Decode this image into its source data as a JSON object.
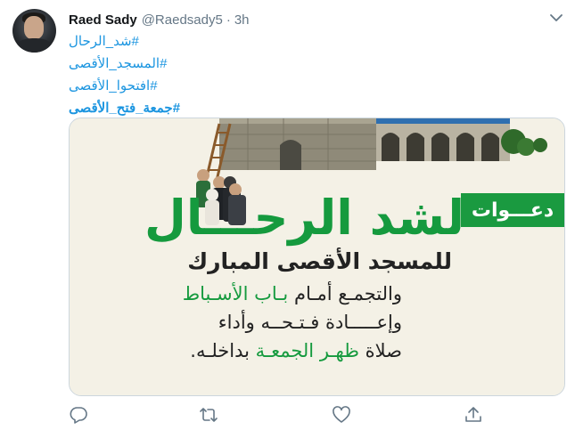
{
  "tweet": {
    "author_name": "Raed Sady",
    "author_handle": "@Raedsady5",
    "separator": "·",
    "time": "3h",
    "hashtags": [
      "#شد_الرحال",
      "#المسجد_الأقصى",
      "#افتحوا_الأقصى",
      "#جمعة_فتح_الأقصى"
    ]
  },
  "media": {
    "badge": "دعـــوات",
    "title": "لشد الرحـــال",
    "subtitle": "للمسجد الأقصى المبارك",
    "line1_pre": "والتجمـع أمـام ",
    "line1_accent": "بـاب الأسـباط",
    "line2": "وإعـــــادة فـتـحــه وأداء",
    "line3_pre": "صلاة ",
    "line3_accent": "ظهـر الجمعـة",
    "line3_post": " بداخلـه."
  },
  "actions": {
    "icons": [
      "reply-icon",
      "retweet-icon",
      "like-icon",
      "share-icon"
    ],
    "accent_color": "#657786"
  },
  "colors": {
    "link": "#1b95e0",
    "green": "#159a3e",
    "muted": "#657786"
  }
}
